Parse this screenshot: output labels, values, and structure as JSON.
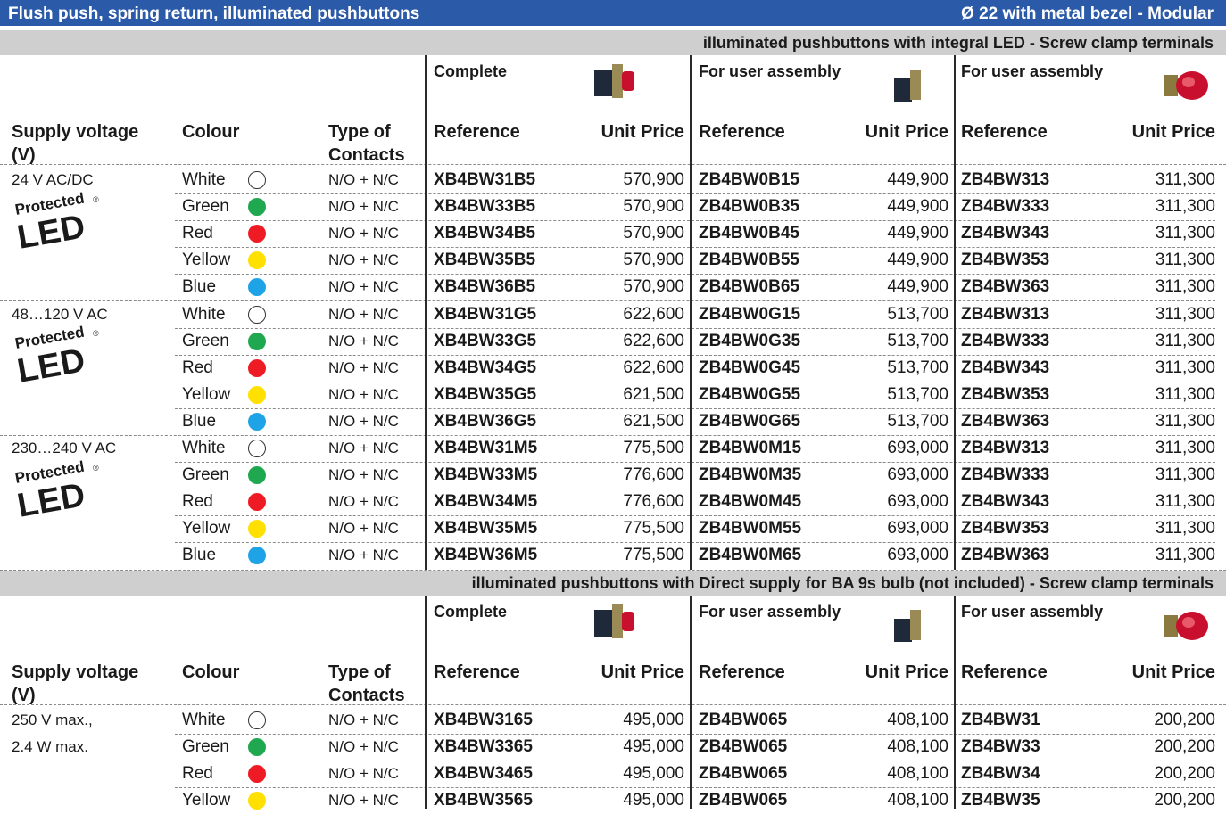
{
  "header": {
    "title": "Flush push, spring return, illuminated pushbuttons",
    "subtitle": "Ø 22 with metal bezel - Modular"
  },
  "colors": {
    "header_bg": "#2b5aa8",
    "band_bg": "#cfcfcf"
  },
  "logo": {
    "line1": "Protected",
    "reg": "®",
    "line2": "LED"
  },
  "sections": [
    {
      "title": "illuminated pushbuttons with integral LED - Screw clamp terminals",
      "products": {
        "complete": "Complete",
        "user1": "For user assembly",
        "user2": "For user assembly"
      },
      "columns": {
        "supply": "Supply voltage (V)",
        "colour": "Colour",
        "contacts": "Type of Contacts",
        "ref1": "Reference",
        "price1": "Unit Price",
        "ref2": "Reference",
        "price2": "Unit Price",
        "ref3": "Reference",
        "price3": "Unit Price"
      },
      "rows": [
        {
          "supply": "24 V AC/DC",
          "colour": "White",
          "dot": "white",
          "contacts": "N/O + N/C",
          "ref1": "XB4BW31B5",
          "price1": "570,900",
          "ref2": "ZB4BW0B15",
          "price2": "449,900",
          "ref3": "ZB4BW313",
          "price3": "311,300"
        },
        {
          "supply": "",
          "colour": "Green",
          "dot": "green",
          "contacts": "N/O + N/C",
          "ref1": "XB4BW33B5",
          "price1": "570,900",
          "ref2": "ZB4BW0B35",
          "price2": "449,900",
          "ref3": "ZB4BW333",
          "price3": "311,300"
        },
        {
          "supply": "",
          "colour": "Red",
          "dot": "red",
          "contacts": "N/O + N/C",
          "ref1": "XB4BW34B5",
          "price1": "570,900",
          "ref2": "ZB4BW0B45",
          "price2": "449,900",
          "ref3": "ZB4BW343",
          "price3": "311,300"
        },
        {
          "supply": "",
          "colour": "Yellow",
          "dot": "yellow",
          "contacts": "N/O + N/C",
          "ref1": "XB4BW35B5",
          "price1": "570,900",
          "ref2": "ZB4BW0B55",
          "price2": "449,900",
          "ref3": "ZB4BW353",
          "price3": "311,300"
        },
        {
          "supply": "",
          "colour": "Blue",
          "dot": "blue",
          "contacts": "N/O + N/C",
          "ref1": "XB4BW36B5",
          "price1": "570,900",
          "ref2": "ZB4BW0B65",
          "price2": "449,900",
          "ref3": "ZB4BW363",
          "price3": "311,300"
        },
        {
          "supply": "48…120 V AC",
          "colour": "White",
          "dot": "white",
          "contacts": "N/O + N/C",
          "ref1": "XB4BW31G5",
          "price1": "622,600",
          "ref2": "ZB4BW0G15",
          "price2": "513,700",
          "ref3": "ZB4BW313",
          "price3": "311,300"
        },
        {
          "supply": "",
          "colour": "Green",
          "dot": "green",
          "contacts": "N/O + N/C",
          "ref1": "XB4BW33G5",
          "price1": "622,600",
          "ref2": "ZB4BW0G35",
          "price2": "513,700",
          "ref3": "ZB4BW333",
          "price3": "311,300"
        },
        {
          "supply": "",
          "colour": "Red",
          "dot": "red",
          "contacts": "N/O + N/C",
          "ref1": "XB4BW34G5",
          "price1": "622,600",
          "ref2": "ZB4BW0G45",
          "price2": "513,700",
          "ref3": "ZB4BW343",
          "price3": "311,300"
        },
        {
          "supply": "",
          "colour": "Yellow",
          "dot": "yellow",
          "contacts": "N/O + N/C",
          "ref1": "XB4BW35G5",
          "price1": "621,500",
          "ref2": "ZB4BW0G55",
          "price2": "513,700",
          "ref3": "ZB4BW353",
          "price3": "311,300"
        },
        {
          "supply": "",
          "colour": "Blue",
          "dot": "blue",
          "contacts": "N/O + N/C",
          "ref1": "XB4BW36G5",
          "price1": "621,500",
          "ref2": "ZB4BW0G65",
          "price2": "513,700",
          "ref3": "ZB4BW363",
          "price3": "311,300"
        },
        {
          "supply": "230…240 V AC",
          "colour": "White",
          "dot": "white",
          "contacts": "N/O + N/C",
          "ref1": "XB4BW31M5",
          "price1": "775,500",
          "ref2": "ZB4BW0M15",
          "price2": "693,000",
          "ref3": "ZB4BW313",
          "price3": "311,300"
        },
        {
          "supply": "",
          "colour": "Green",
          "dot": "green",
          "contacts": "N/O + N/C",
          "ref1": "XB4BW33M5",
          "price1": "776,600",
          "ref2": "ZB4BW0M35",
          "price2": "693,000",
          "ref3": "ZB4BW333",
          "price3": "311,300"
        },
        {
          "supply": "",
          "colour": "Red",
          "dot": "red",
          "contacts": "N/O + N/C",
          "ref1": "XB4BW34M5",
          "price1": "776,600",
          "ref2": "ZB4BW0M45",
          "price2": "693,000",
          "ref3": "ZB4BW343",
          "price3": "311,300"
        },
        {
          "supply": "",
          "colour": "Yellow",
          "dot": "yellow",
          "contacts": "N/O + N/C",
          "ref1": "XB4BW35M5",
          "price1": "775,500",
          "ref2": "ZB4BW0M55",
          "price2": "693,000",
          "ref3": "ZB4BW353",
          "price3": "311,300"
        },
        {
          "supply": "",
          "colour": "Blue",
          "dot": "blue",
          "contacts": "N/O + N/C",
          "ref1": "XB4BW36M5",
          "price1": "775,500",
          "ref2": "ZB4BW0M65",
          "price2": "693,000",
          "ref3": "ZB4BW363",
          "price3": "311,300"
        }
      ]
    },
    {
      "title": "illuminated pushbuttons with Direct supply for BA 9s bulb (not included) - Screw clamp terminals",
      "products": {
        "complete": "Complete",
        "user1": "For user assembly",
        "user2": "For user assembly"
      },
      "columns": {
        "supply": "Supply voltage (V)",
        "colour": "Colour",
        "contacts": "Type of Contacts",
        "ref1": "Reference",
        "price1": "Unit Price",
        "ref2": "Reference",
        "price2": "Unit Price",
        "ref3": "Reference",
        "price3": "Unit Price"
      },
      "rows": [
        {
          "supply": "250 V max.,",
          "colour": "White",
          "dot": "white",
          "contacts": "N/O + N/C",
          "ref1": "XB4BW3165",
          "price1": "495,000",
          "ref2": "ZB4BW065",
          "price2": "408,100",
          "ref3": "ZB4BW31",
          "price3": "200,200"
        },
        {
          "supply": "2.4 W max.",
          "colour": "Green",
          "dot": "green",
          "contacts": "N/O + N/C",
          "ref1": "XB4BW3365",
          "price1": "495,000",
          "ref2": "ZB4BW065",
          "price2": "408,100",
          "ref3": "ZB4BW33",
          "price3": "200,200"
        },
        {
          "supply": "",
          "colour": "Red",
          "dot": "red",
          "contacts": "N/O + N/C",
          "ref1": "XB4BW3465",
          "price1": "495,000",
          "ref2": "ZB4BW065",
          "price2": "408,100",
          "ref3": "ZB4BW34",
          "price3": "200,200"
        },
        {
          "supply": "",
          "colour": "Yellow",
          "dot": "yellow",
          "contacts": "N/O + N/C",
          "ref1": "XB4BW3565",
          "price1": "495,000",
          "ref2": "ZB4BW065",
          "price2": "408,100",
          "ref3": "ZB4BW35",
          "price3": "200,200"
        }
      ]
    }
  ]
}
